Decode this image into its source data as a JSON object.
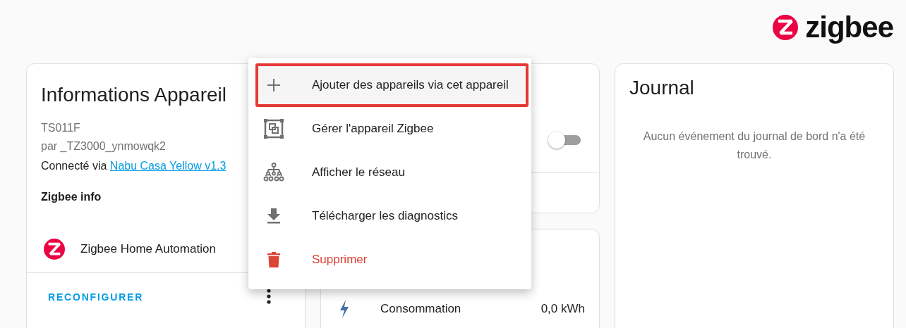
{
  "logo": {
    "text": "zigbee"
  },
  "device_info": {
    "title": "Informations Appareil",
    "model": "TS011F",
    "manufacturer": "par _TZ3000_ynmowqk2",
    "connected_prefix": "Connecté via",
    "connected_link": "Nabu Casa Yellow v1.3",
    "section": "Zigbee info",
    "integration": "Zigbee Home Automation",
    "action": "RECONFIGURER"
  },
  "controls_card": {
    "toggle": {
      "on": false
    }
  },
  "sensors_card": {
    "rows": [
      {
        "label": "Consommation",
        "value": "0,0 kWh"
      }
    ]
  },
  "logbook": {
    "title": "Journal",
    "empty_message": "Aucun événement du journal de bord n'a été trouvé."
  },
  "menu": {
    "items": [
      {
        "kind": "add",
        "label": "Ajouter des appareils via cet appareil",
        "selected": true
      },
      {
        "kind": "manage",
        "label": "Gérer l'appareil Zigbee",
        "selected": false
      },
      {
        "kind": "network",
        "label": "Afficher le réseau",
        "selected": false
      },
      {
        "kind": "download",
        "label": "Télécharger les diagnostics",
        "selected": false
      },
      {
        "kind": "delete",
        "label": "Supprimer",
        "selected": false
      }
    ]
  }
}
